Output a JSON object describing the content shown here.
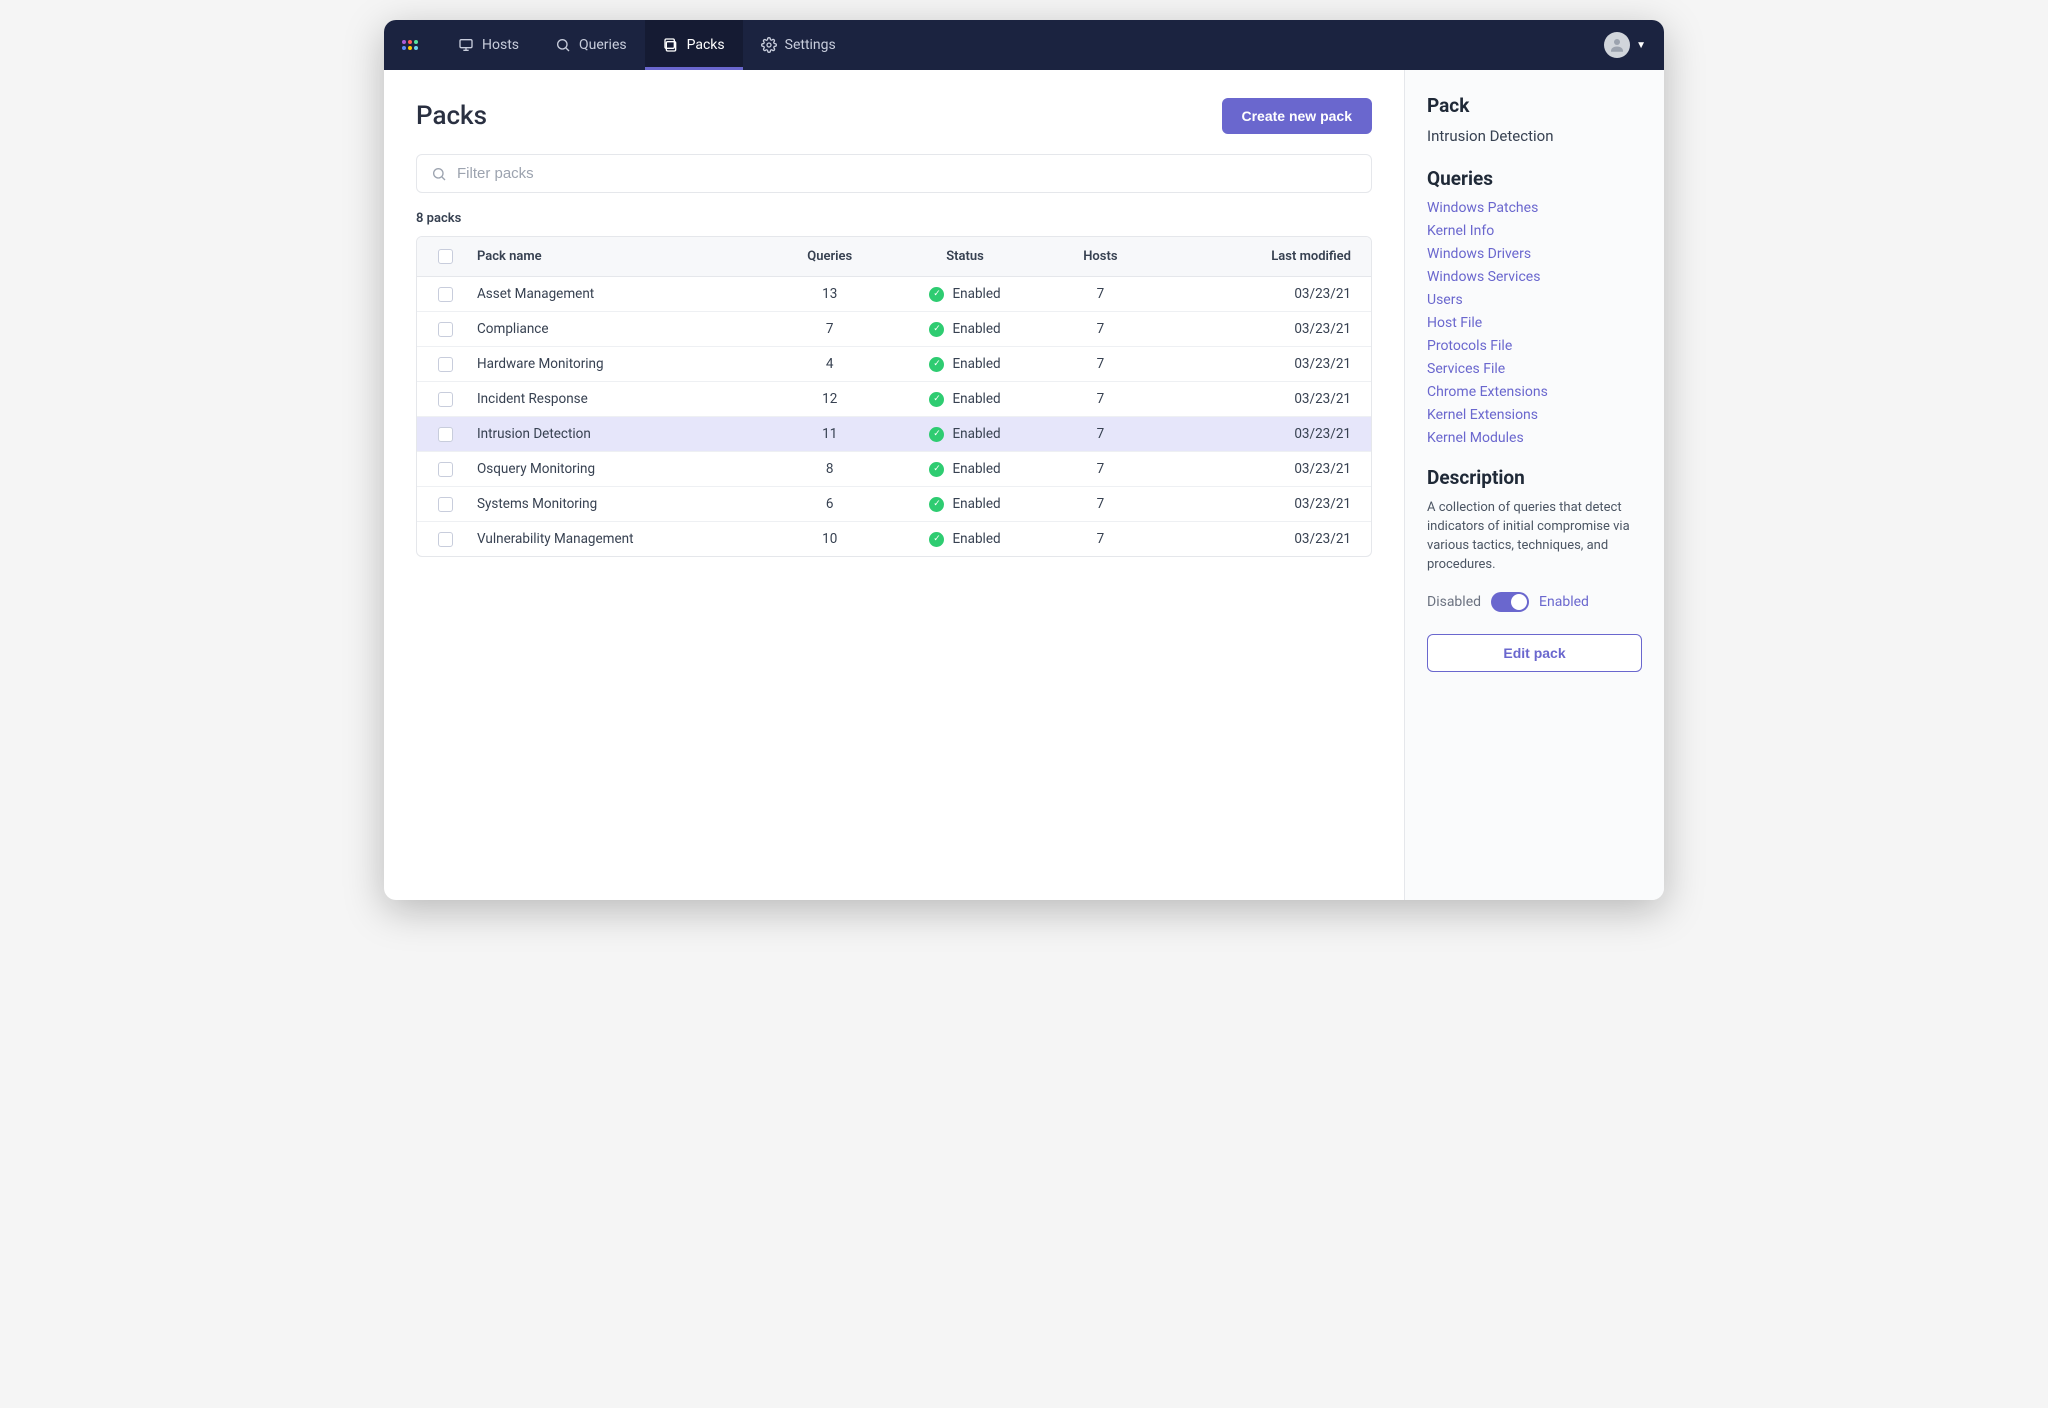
{
  "nav": {
    "items": [
      {
        "label": "Hosts"
      },
      {
        "label": "Queries"
      },
      {
        "label": "Packs"
      },
      {
        "label": "Settings"
      }
    ]
  },
  "page": {
    "title": "Packs",
    "create_label": "Create new pack",
    "filter_placeholder": "Filter packs",
    "count_label": "8 packs"
  },
  "table": {
    "headers": {
      "name": "Pack name",
      "queries": "Queries",
      "status": "Status",
      "hosts": "Hosts",
      "modified": "Last modified"
    },
    "rows": [
      {
        "name": "Asset Management",
        "queries": "13",
        "status": "Enabled",
        "hosts": "7",
        "modified": "03/23/21",
        "selected": false
      },
      {
        "name": "Compliance",
        "queries": "7",
        "status": "Enabled",
        "hosts": "7",
        "modified": "03/23/21",
        "selected": false
      },
      {
        "name": "Hardware Monitoring",
        "queries": "4",
        "status": "Enabled",
        "hosts": "7",
        "modified": "03/23/21",
        "selected": false
      },
      {
        "name": "Incident Response",
        "queries": "12",
        "status": "Enabled",
        "hosts": "7",
        "modified": "03/23/21",
        "selected": false
      },
      {
        "name": "Intrusion Detection",
        "queries": "11",
        "status": "Enabled",
        "hosts": "7",
        "modified": "03/23/21",
        "selected": true
      },
      {
        "name": "Osquery Monitoring",
        "queries": "8",
        "status": "Enabled",
        "hosts": "7",
        "modified": "03/23/21",
        "selected": false
      },
      {
        "name": "Systems Monitoring",
        "queries": "6",
        "status": "Enabled",
        "hosts": "7",
        "modified": "03/23/21",
        "selected": false
      },
      {
        "name": "Vulnerability Management",
        "queries": "10",
        "status": "Enabled",
        "hosts": "7",
        "modified": "03/23/21",
        "selected": false
      }
    ]
  },
  "side": {
    "pack_heading": "Pack",
    "pack_name": "Intrusion Detection",
    "queries_heading": "Queries",
    "queries": [
      "Windows Patches",
      "Kernel Info",
      "Windows Drivers",
      "Windows Services",
      "Users",
      "Host File",
      "Protocols File",
      "Services File",
      "Chrome Extensions",
      "Kernel Extensions",
      "Kernel Modules"
    ],
    "description_heading": "Description",
    "description_text": "A collection of queries that detect indicators of initial compromise via various tactics, techniques, and procedures.",
    "toggle_off": "Disabled",
    "toggle_on": "Enabled",
    "edit_label": "Edit pack"
  }
}
